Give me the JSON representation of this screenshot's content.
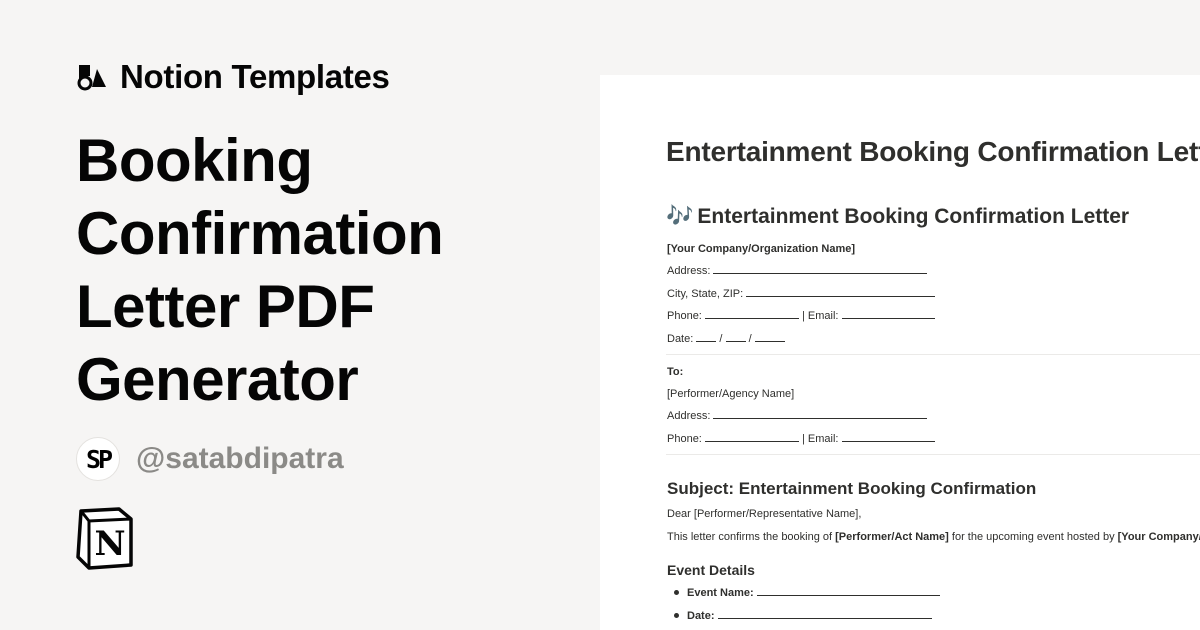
{
  "brand": {
    "name": "Notion Templates",
    "icon": "shapes-icon"
  },
  "title_lines": [
    "Booking",
    "Confirmation",
    "Letter PDF",
    "Generator"
  ],
  "author": {
    "initials": "SP",
    "handle": "@satabdipatra"
  },
  "logo": {
    "letter": "N"
  },
  "doc": {
    "title": "Entertainment Booking Confirmation Letter",
    "heading_emoji": "🎶",
    "heading": "Entertainment Booking Confirmation Letter",
    "company": "[Your Company/Organization Name]",
    "address_label": "Address:",
    "city_label": "City, State, ZIP:",
    "phone_label": "Phone:",
    "email_sep": "| Email:",
    "date_label": "Date:",
    "date_sep": "/",
    "to_label": "To:",
    "performer_name": "[Performer/Agency Name]",
    "subject": "Subject: Entertainment Booking Confirmation",
    "greeting": "Dear [Performer/Representative Name],",
    "body_prefix": "This letter confirms the booking of",
    "body_act": "[Performer/Act Name]",
    "body_mid": "for the upcoming event hosted by",
    "body_host": "[Your Company/Organization Name]",
    "event_heading": "Event Details",
    "event_items": [
      "Event Name:",
      "Date:"
    ]
  },
  "colors": {
    "background": "#f6f5f4",
    "doc_background": "#ffffff",
    "muted": "#8b8a87",
    "text": "#050505"
  }
}
